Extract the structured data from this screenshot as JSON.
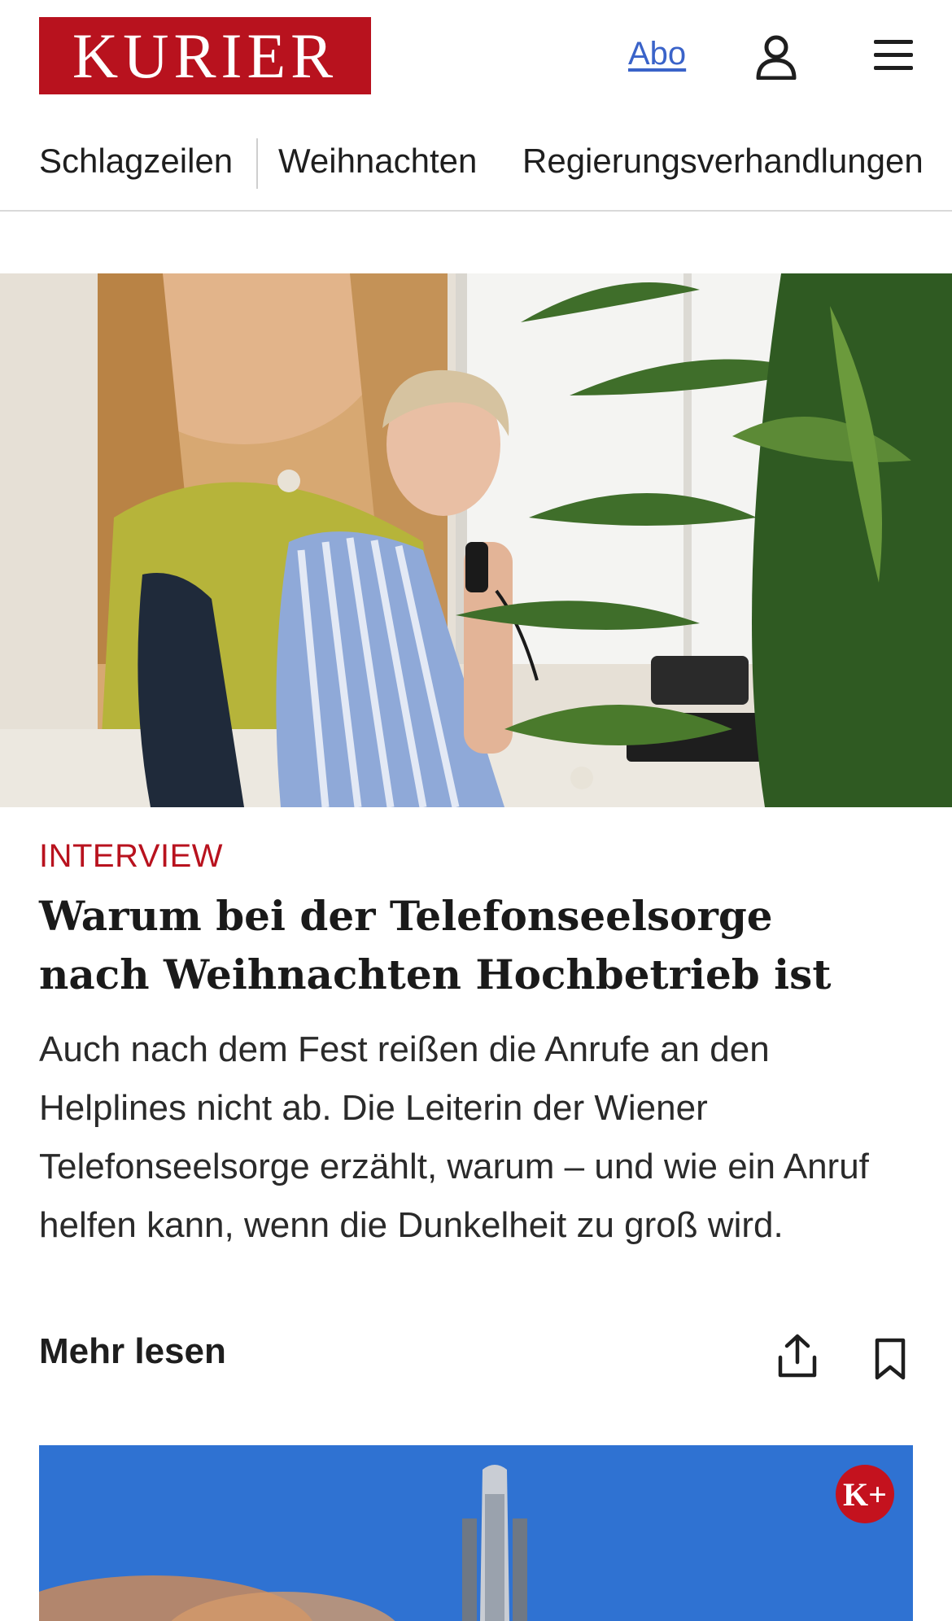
{
  "header": {
    "logo_text": "KURIER",
    "abo_label": "Abo",
    "brand_color": "#b8121e",
    "link_color": "#3a63c9",
    "icons": [
      "user-icon",
      "menu-icon"
    ]
  },
  "nav": {
    "items": [
      {
        "label": "Schlagzeilen"
      },
      {
        "label": "Weihnachten"
      },
      {
        "label": "Regierungsverhandlungen"
      }
    ]
  },
  "article": {
    "kicker": "INTERVIEW",
    "headline": "Warum bei der Telefonseelsorge nach Weihnachten Hochbetrieb ist",
    "teaser": "Auch nach dem Fest reißen die Anrufe an den Helplines nicht ab. Die Leiterin der Wiener Telefonseelsorge erzählt, warum – und wie ein Anruf helfen kann, wenn die Dunkelheit zu groß wird.",
    "more_label": "Mehr lesen",
    "icons": [
      "share-icon",
      "bookmark-icon"
    ]
  },
  "next_article": {
    "badge": "K+"
  }
}
